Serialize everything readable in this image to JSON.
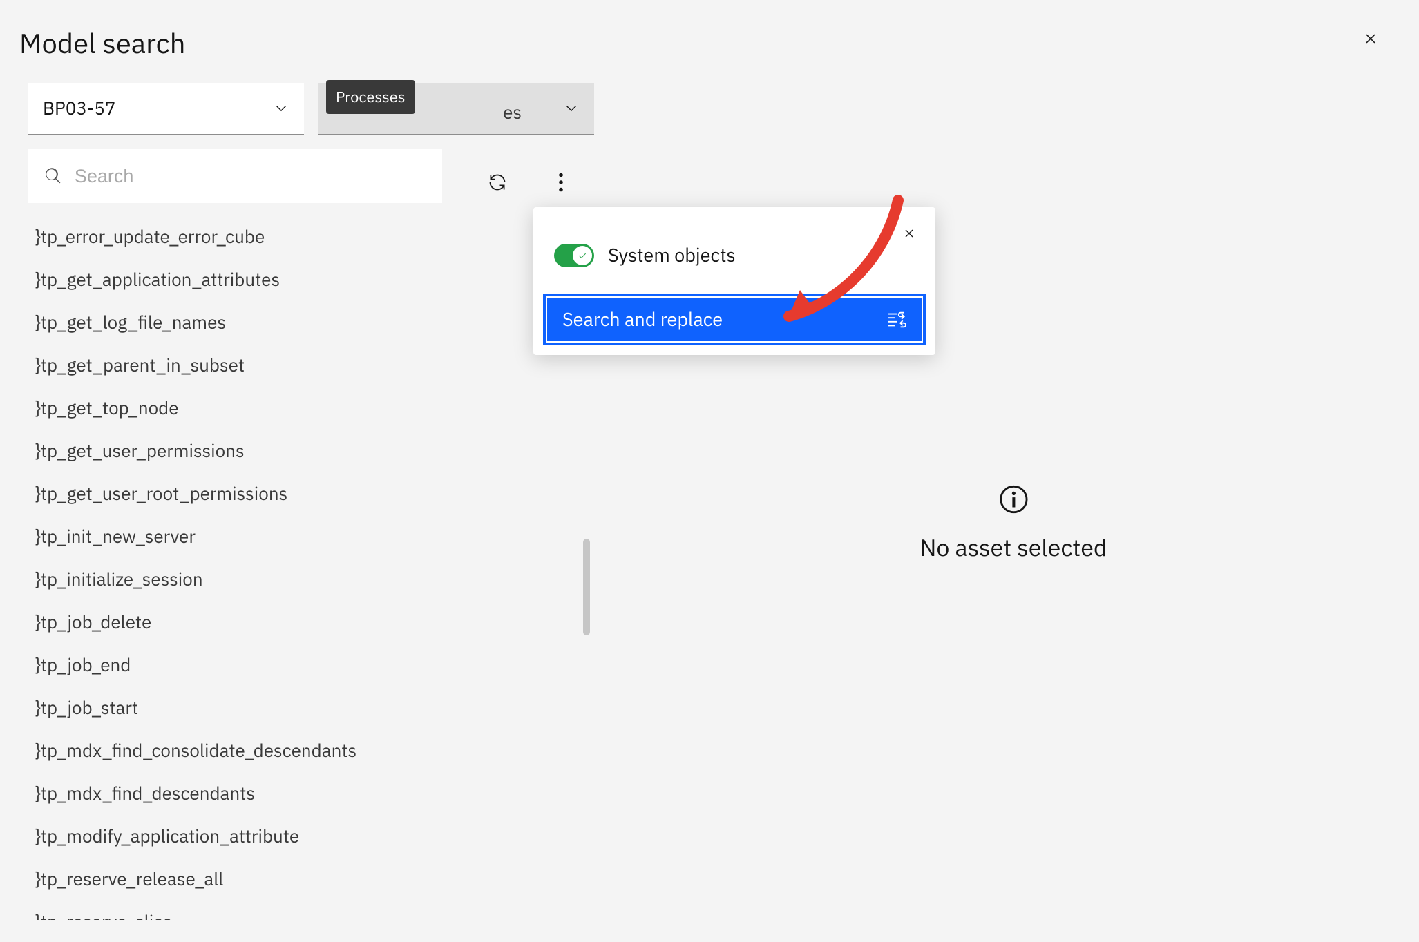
{
  "header": {
    "title": "Model search"
  },
  "dropdowns": {
    "database": "BP03-57",
    "object_type_hidden": "Processes",
    "object_type_suffix": "es",
    "tooltip": "Processes"
  },
  "search": {
    "placeholder": "Search",
    "value": ""
  },
  "list_items": [
    "}tp_error_update_error_cube",
    "}tp_get_application_attributes",
    "}tp_get_log_file_names",
    "}tp_get_parent_in_subset",
    "}tp_get_top_node",
    "}tp_get_user_permissions",
    "}tp_get_user_root_permissions",
    "}tp_init_new_server",
    "}tp_initialize_session",
    "}tp_job_delete",
    "}tp_job_end",
    "}tp_job_start",
    "}tp_mdx_find_consolidate_descendants",
    "}tp_mdx_find_descendants",
    "}tp_modify_application_attribute",
    "}tp_reserve_release_all",
    "}tp_reserve_slice"
  ],
  "menu": {
    "system_objects_label": "System objects",
    "system_objects_on": true,
    "search_replace_label": "Search and replace"
  },
  "right_pane": {
    "empty_message": "No asset selected"
  }
}
